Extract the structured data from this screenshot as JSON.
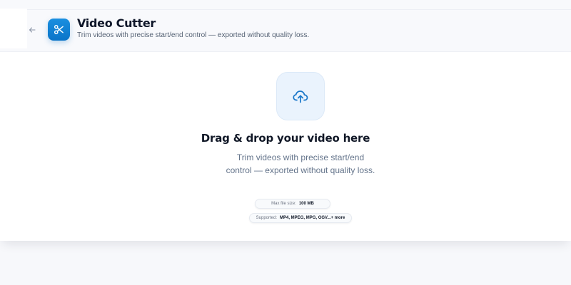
{
  "header": {
    "title": "Video Cutter",
    "subtitle": "Trim videos with precise start/end control — exported without quality loss.",
    "back_icon": "arrow-left-icon",
    "app_icon": "scissors-icon"
  },
  "dropzone": {
    "icon": "cloud-upload-icon",
    "title": "Drag & drop your video here",
    "description": "Trim videos with precise start/end control — exported without quality loss.",
    "max_size_label": "Max file size:",
    "max_size_value": "100 MB",
    "supported_label": "Supported:",
    "supported_value": "MP4, MPEG, MPG, OGV...+ more"
  },
  "colors": {
    "accent": "#0a74c8",
    "upload_tile_bg": "#eaf3fd"
  }
}
